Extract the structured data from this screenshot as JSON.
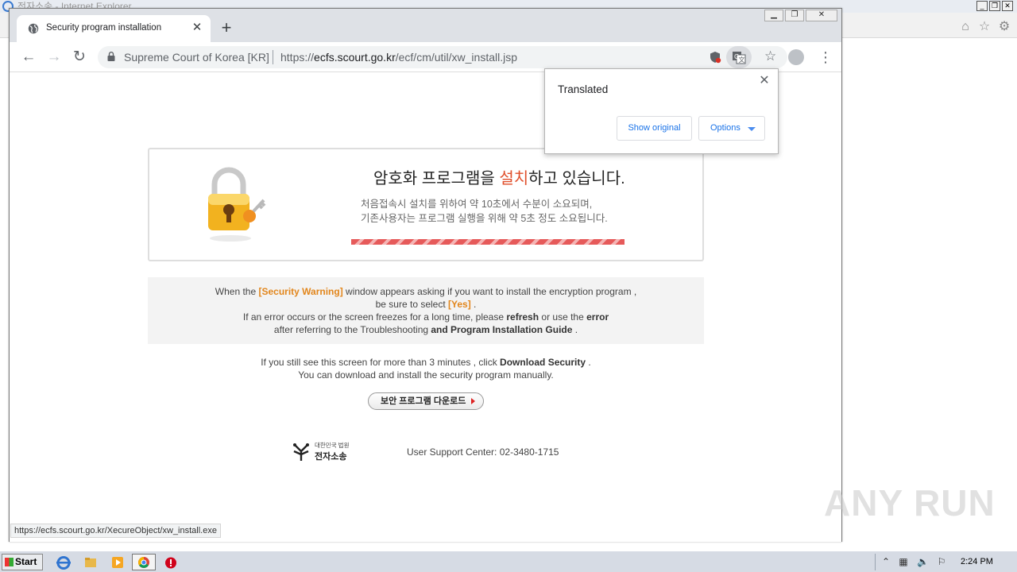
{
  "ie": {
    "title": "전자소송 - Internet Explorer"
  },
  "tab": {
    "title": "Security program installation"
  },
  "omnibox": {
    "origin_label": "Supreme Court of Korea [KR]",
    "url_scheme": "https://",
    "url_host": "ecfs.scourt.go.kr",
    "url_path": "/ecf/cm/util/xw_install.jsp"
  },
  "translate_popup": {
    "title": "Translated",
    "show_original": "Show original",
    "options": "Options"
  },
  "install": {
    "title_before": "암호화 프로그램을 ",
    "title_highlight": "설치",
    "title_after": "하고 있습니다.",
    "desc_line1": "처음접속시 설치를 위하여 약 10초에서 수분이 소요되며,",
    "desc_line2": "기존사용자는 프로그램 실행을 위해 약 5초 정도 소요됩니다."
  },
  "notice": {
    "l1_a": "When the ",
    "l1_b": "[Security Warning]",
    "l1_c": " window appears asking if you want to install the encryption program ,",
    "l2_a": "be sure to select ",
    "l2_b": "[Yes]",
    "l2_c": " .",
    "l3_a": "If an error occurs or the screen freezes for a long time, please ",
    "l3_b": "refresh",
    "l3_c": " or use the ",
    "l3_d": "error",
    "l4_a": "after referring to the Troubleshooting ",
    "l4_b": "and Program Installation Guide",
    "l4_c": " ."
  },
  "after": {
    "l1_a": "If you still see this screen for more than 3 minutes , click ",
    "l1_b": "Download Security",
    "l1_c": " .",
    "l2": "You can download and install the security program manually."
  },
  "download_button": "보안 프로그램 다운로드",
  "court_logo": {
    "small": "대한민국 법원",
    "big": "전자소송"
  },
  "support": "User Support Center: 02-3480-1715",
  "status_url": "https://ecfs.scourt.go.kr/XecureObject/xw_install.exe",
  "taskbar": {
    "start": "Start",
    "clock": "2:24 PM"
  },
  "watermark": "ANY RUN",
  "colors": {
    "accent_orange": "#e2861c",
    "title_highlight": "#e04e2a",
    "chrome_frame": "#dee1e6",
    "link_blue": "#1a73e8"
  }
}
